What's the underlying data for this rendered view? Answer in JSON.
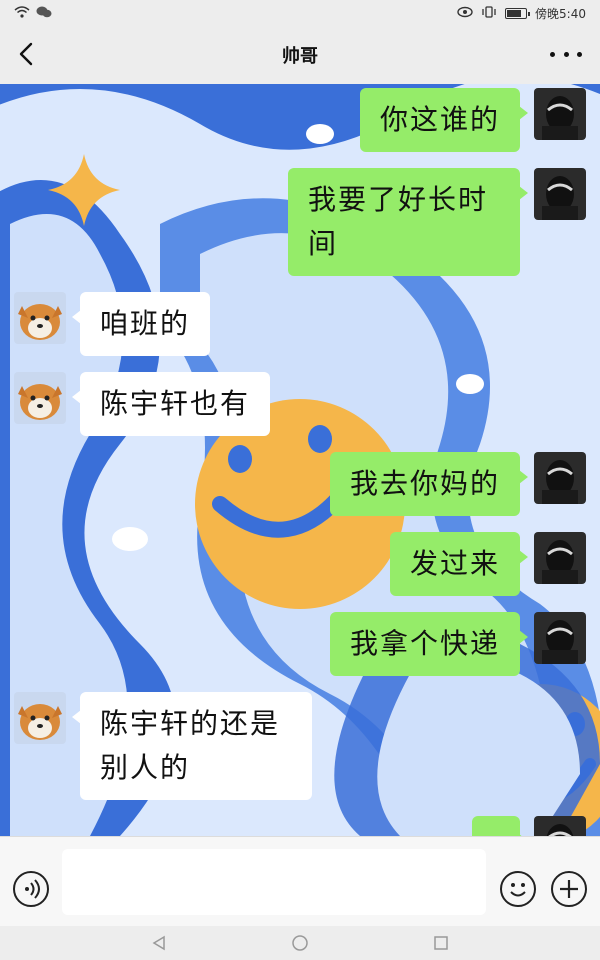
{
  "status_bar": {
    "left_icons": [
      "wifi-icon",
      "wechat-icon"
    ],
    "right_icons": [
      "eye-icon",
      "vibrate-icon",
      "battery-icon"
    ],
    "battery_level": 0.85,
    "time_text": "傍晚5:40"
  },
  "header": {
    "title": "帅哥",
    "back_icon": "back-arrow-icon",
    "more_icon": "more-icon"
  },
  "chat": {
    "messages": [
      {
        "sender": "me",
        "lines": [
          "你这谁的"
        ]
      },
      {
        "sender": "me",
        "lines": [
          "我要了好长时",
          "间"
        ]
      },
      {
        "sender": "other",
        "lines": [
          "咱班的"
        ]
      },
      {
        "sender": "other",
        "lines": [
          "陈宇轩也有"
        ]
      },
      {
        "sender": "me",
        "lines": [
          "我去你妈的"
        ]
      },
      {
        "sender": "me",
        "lines": [
          "发过来"
        ]
      },
      {
        "sender": "me",
        "lines": [
          "我拿个快递"
        ]
      },
      {
        "sender": "other",
        "lines": [
          "陈宇轩的还是",
          "别人的"
        ]
      },
      {
        "sender": "me",
        "lines": [
          ""
        ]
      }
    ]
  },
  "input_bar": {
    "voice_icon": "voice-icon",
    "input_value": "",
    "emoji_icon": "emoji-icon",
    "plus_icon": "plus-icon"
  },
  "nav_bar": {
    "icons": [
      "nav-back-icon",
      "nav-home-icon",
      "nav-recents-icon"
    ]
  },
  "colors": {
    "my_bubble": "#95ec69",
    "other_bubble": "#ffffff",
    "background": "#ededed",
    "wallpaper_blue": "#3a6fd8",
    "wallpaper_light": "#cfe0fb",
    "wallpaper_yellow": "#f5b64a"
  }
}
